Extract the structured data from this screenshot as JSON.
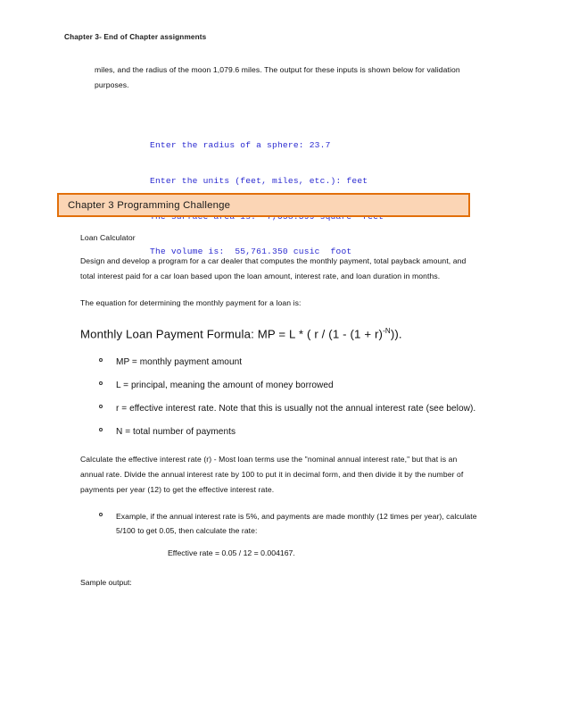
{
  "document": {
    "running_header": "Chapter 3- End of Chapter assignments",
    "intro_paragraph": "miles, and the radius of the moon 1,079.6 miles.  The output for these inputs is shown below for validation purposes.",
    "console_output": [
      "Enter the radius of a sphere: 23.7",
      "Enter the units (feet, miles, etc.): feet",
      "The surface area is:  7,058.399 square  feet",
      "The volume is:  55,761.350 cusic  foot"
    ],
    "console_color": "#2a2ad0",
    "heading": {
      "text": "Chapter 3 Programming Challenge",
      "border_color": "#e2700b",
      "fill_color": "#fbd5b5"
    },
    "section_title": "Loan Calculator",
    "description": "Design and develop a program for a car dealer that computes the monthly payment, total payback amount, and total interest paid for a car loan based upon the loan amount, interest rate, and loan duration in months.",
    "equation_intro": "The equation for determining the monthly payment for a loan is:",
    "formula": {
      "prefix": "Monthly Loan Payment Formula: MP = L * ( r / (1 - (1 + r)",
      "exponent": "-N",
      "suffix": "))."
    },
    "variables": [
      "MP = monthly payment amount",
      "L = principal, meaning the amount of money borrowed",
      "r = effective interest rate. Note that this is usually not the annual interest rate (see below).",
      "N = total number of payments"
    ],
    "effective_rate_paragraph": "Calculate the effective interest rate (r) - Most loan terms use the \"nominal annual interest rate,\" but that is an annual rate. Divide the annual interest rate by 100 to put it in decimal form, and then divide it by the number of payments per year (12) to get the effective interest rate.",
    "example_bullet": "Example, if the annual interest rate is 5%, and payments are made monthly (12 times per year), calculate 5/100 to get 0.05, then calculate the rate:",
    "effective_rate_equation": "Effective rate = 0.05 / 12 = 0.004167.",
    "sample_output_label": "Sample output:"
  }
}
